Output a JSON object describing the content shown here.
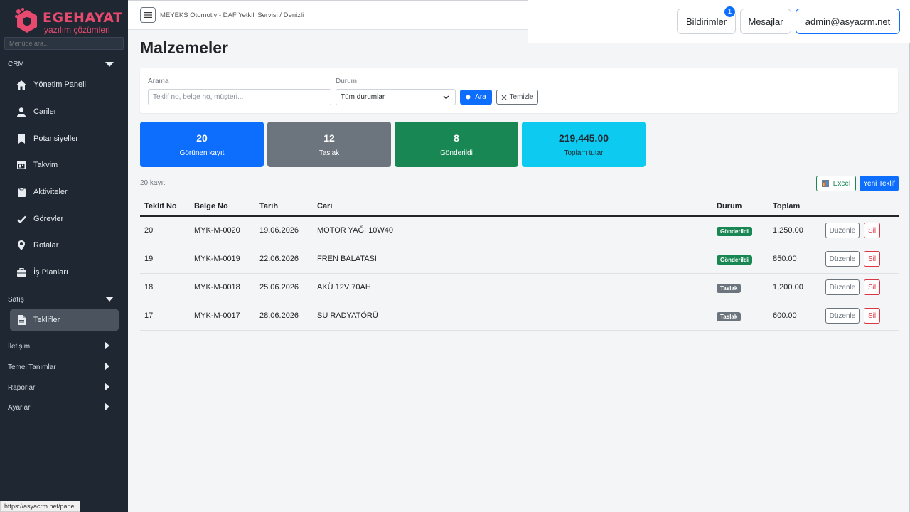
{
  "logo": {
    "brand": "EGEHAYAT",
    "sub": "yazılım çözümleri"
  },
  "sidebar": {
    "search_placeholder": "Menüde ara...",
    "sections": [
      {
        "label": "CRM"
      },
      {
        "label": "Satış"
      }
    ],
    "items": [
      {
        "label": "Yönetim Paneli",
        "icon": "home-icon"
      },
      {
        "label": "Cariler",
        "icon": "user-icon"
      },
      {
        "label": "Potansiyeller",
        "icon": "bookmark-icon"
      },
      {
        "label": "Takvim",
        "icon": "calendar-icon"
      },
      {
        "label": "Aktiviteler",
        "icon": "clipboard-icon"
      },
      {
        "label": "Görevler",
        "icon": "check-icon"
      },
      {
        "label": "Rotalar",
        "icon": "map-pin-icon"
      },
      {
        "label": "İş Planları",
        "icon": "briefcase-icon"
      },
      {
        "label": "Teklifler",
        "icon": "document-icon"
      }
    ],
    "collapsed": [
      {
        "label": "İletişim"
      },
      {
        "label": "Temel Tanımlar"
      },
      {
        "label": "Raporlar"
      },
      {
        "label": "Ayarlar"
      }
    ]
  },
  "statusbar": {
    "url": "https://asyacrm.net/panel"
  },
  "topbar": {
    "breadcrumb": "MEYEKS Otomotiv - DAF Yetkili Servisi / Denizli",
    "notifications_label": "Bildirimler",
    "notifications_count": "1",
    "messages_label": "Mesajlar",
    "user_label": "admin@asyacrm.net"
  },
  "main": {
    "title": "Malzemeler",
    "filters": {
      "search_label": "Arama",
      "search_placeholder": "Teklif no, belge no, müşteri...",
      "status_label": "Durum",
      "status_value": "Tüm durumlar",
      "search_button": "Ara",
      "clear_button": "Temizle"
    },
    "stats": [
      {
        "value": "20",
        "label": "Görünen kayıt",
        "color": "#0d6efd"
      },
      {
        "value": "12",
        "label": "Taslak",
        "color": "#6c757d"
      },
      {
        "value": "8",
        "label": "Gönderildi",
        "color": "#198754"
      },
      {
        "value": "219,445.00",
        "label": "Toplam tutar",
        "color": "#0dcaf0"
      }
    ],
    "record_count": "20 kayıt",
    "excel_button": "Excel",
    "new_button": "Yeni Teklif",
    "table": {
      "headers": [
        "Teklif No",
        "Belge No",
        "Tarih",
        "Cari",
        "Durum",
        "Toplam"
      ],
      "rows": [
        {
          "no": "20",
          "belge": "MYK-M-0020",
          "tarih": "19.06.2026",
          "cari": "MOTOR YAĞI 10W40",
          "durum": "Gönderildi",
          "toplam": "1,250.00"
        },
        {
          "no": "19",
          "belge": "MYK-M-0019",
          "tarih": "22.06.2026",
          "cari": "FREN BALATASI",
          "durum": "Gönderildi",
          "toplam": "850.00"
        },
        {
          "no": "18",
          "belge": "MYK-M-0018",
          "tarih": "25.06.2026",
          "cari": "AKÜ 12V 70AH",
          "durum": "Taslak",
          "toplam": "1,200.00"
        },
        {
          "no": "17",
          "belge": "MYK-M-0017",
          "tarih": "28.06.2026",
          "cari": "SU RADYATÖRÜ",
          "durum": "Taslak",
          "toplam": "600.00"
        }
      ],
      "edit_label": "Düzenle",
      "delete_label": "Sil"
    },
    "status_colors": {
      "Gönderildi": "#198754",
      "Taslak": "#6c757d"
    }
  }
}
